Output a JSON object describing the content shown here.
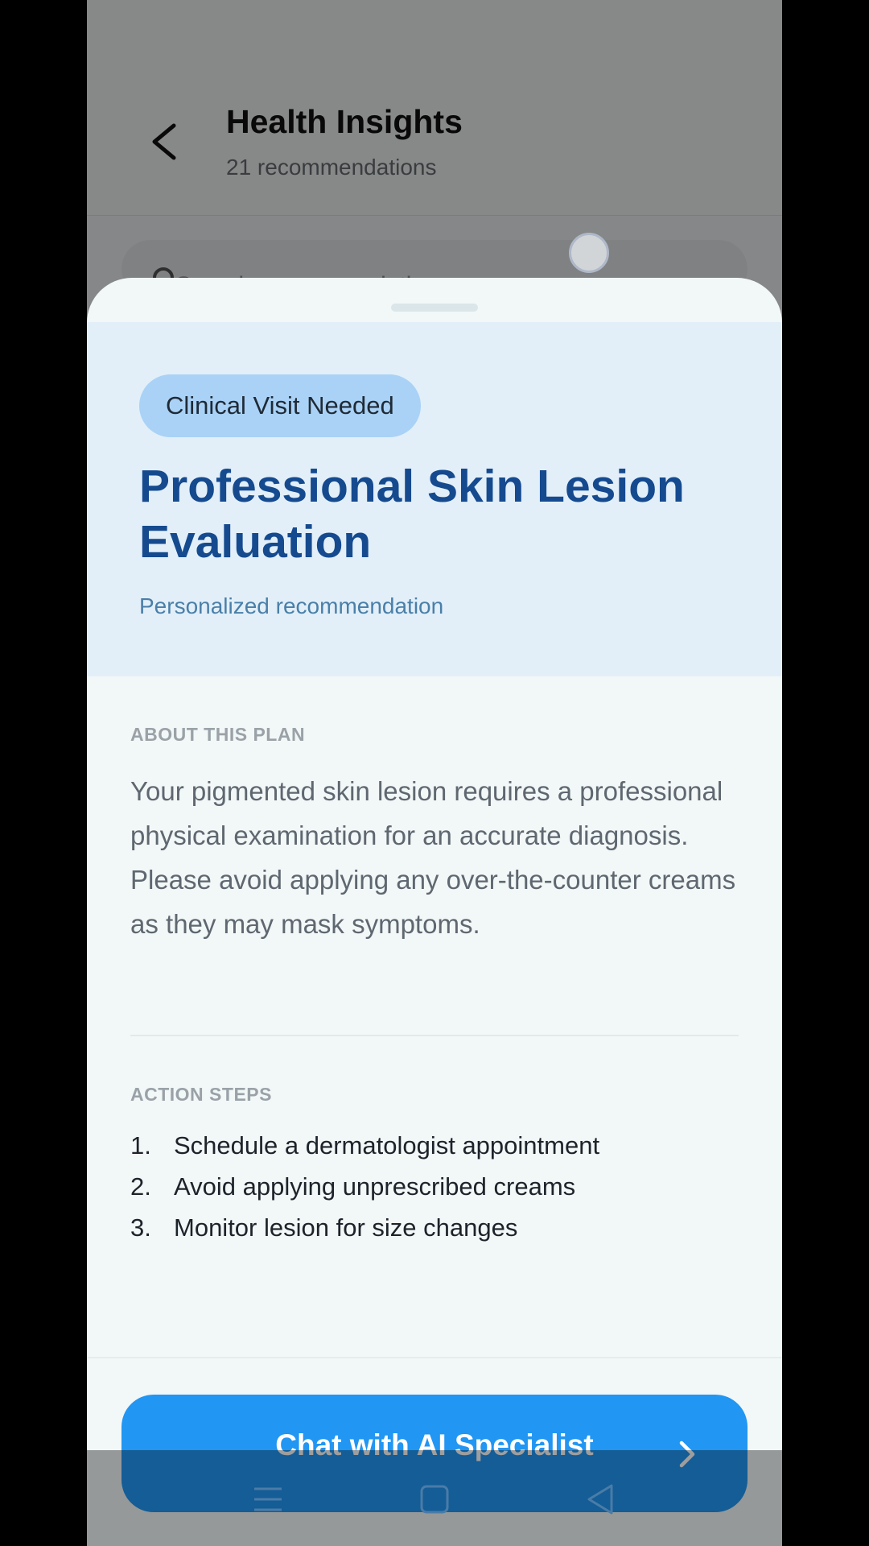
{
  "background_page": {
    "title": "Health Insights",
    "subtitle": "21 recommendations",
    "search_placeholder": "Search recommendations"
  },
  "sheet": {
    "badge": "Clinical Visit Needed",
    "title": "Professional Skin Lesion Evaluation",
    "subtitle": "Personalized recommendation",
    "about_label": "ABOUT THIS PLAN",
    "about_text": "Your pigmented skin lesion requires a professional physical examination for an accurate diagnosis. Please avoid applying any over-the-counter creams as they may mask symptoms.",
    "steps_label": "ACTION STEPS",
    "steps": [
      {
        "num": "1.",
        "text": "Schedule a dermatologist appointment"
      },
      {
        "num": "2.",
        "text": "Avoid applying unprescribed creams"
      },
      {
        "num": "3.",
        "text": "Monitor lesion for size changes"
      }
    ],
    "cta_label": "Chat with AI Specialist"
  },
  "icons": {
    "back": "chevron-left-icon",
    "search": "search-icon",
    "cta_arrow": "chevron-right-icon",
    "nav_menu": "menu-icon",
    "nav_home": "square-icon",
    "nav_back": "triangle-back-icon"
  },
  "colors": {
    "accent": "#2196f3",
    "title": "#154a8f",
    "badge_bg": "#a9d2f6",
    "hero_bg": "#e2eff9"
  }
}
